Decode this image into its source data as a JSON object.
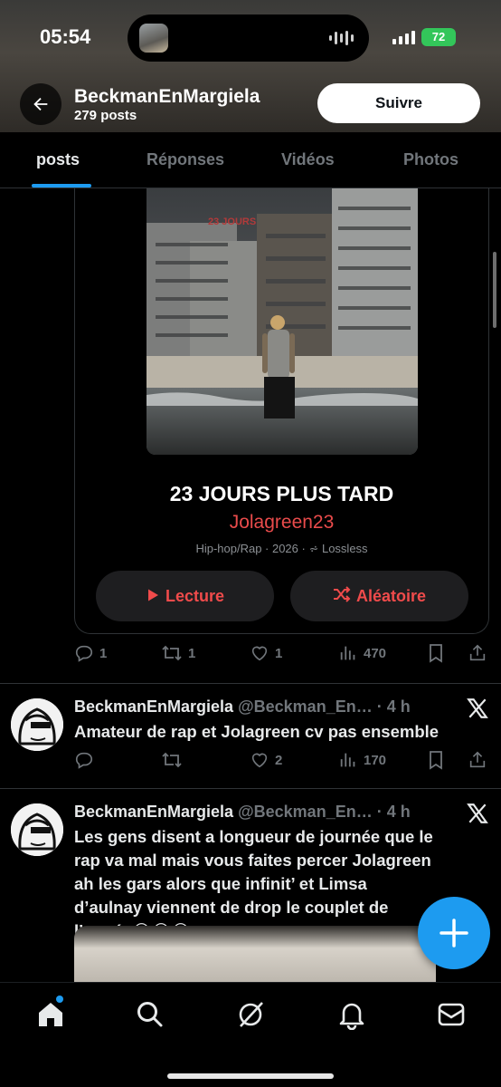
{
  "status": {
    "time": "05:54",
    "battery": "72"
  },
  "profile": {
    "name": "BeckmanEnMargiela",
    "posts_count": "279 posts",
    "follow_label": "Suivre"
  },
  "tabs": [
    {
      "label": "posts",
      "active": true
    },
    {
      "label": "Réponses",
      "active": false
    },
    {
      "label": "Vidéos",
      "active": false
    },
    {
      "label": "Photos",
      "active": false
    }
  ],
  "album": {
    "cover_text": "23 JOURS",
    "title": "23 JOURS PLUS TARD",
    "artist": "Jolagreen23",
    "meta": "Hip-hop/Rap · 2026 · ",
    "lossless": "Lossless",
    "play_label": "Lecture",
    "shuffle_label": "Aléatoire",
    "accent_color": "#e94b4b"
  },
  "post1_actions": {
    "replies": "1",
    "reposts": "1",
    "likes": "1",
    "views": "470"
  },
  "tweets": [
    {
      "name": "BeckmanEnMargiela",
      "handle": "@Beckman_En…",
      "time": "· 4 h",
      "text": "Amateur de rap et Jolagreen cv pas ensemble",
      "replies": "",
      "reposts": "",
      "likes": "2",
      "views": "170"
    },
    {
      "name": "BeckmanEnMargiela",
      "handle": "@Beckman_En…",
      "time": "· 4 h",
      "text": "Les gens disent a longueur de journée que le rap va mal mais vous faites percer Jolagreen ah les gars alors que infinit’ et Limsa d’aulnay viennent de drop le couplet de l’année😂😂😂"
    }
  ],
  "icons": {
    "back": "arrow-left-icon",
    "reply": "reply-icon",
    "repost": "repost-icon",
    "like": "heart-icon",
    "views": "views-icon",
    "bookmark": "bookmark-icon",
    "share": "share-icon",
    "x": "x-logo-icon",
    "compose": "plus-icon",
    "home": "home-icon",
    "search": "search-icon",
    "grok": "grok-icon",
    "notifications": "bell-icon",
    "messages": "mail-icon"
  },
  "colors": {
    "accent": "#1d9bf0",
    "background": "#000000",
    "muted": "#71767b"
  }
}
